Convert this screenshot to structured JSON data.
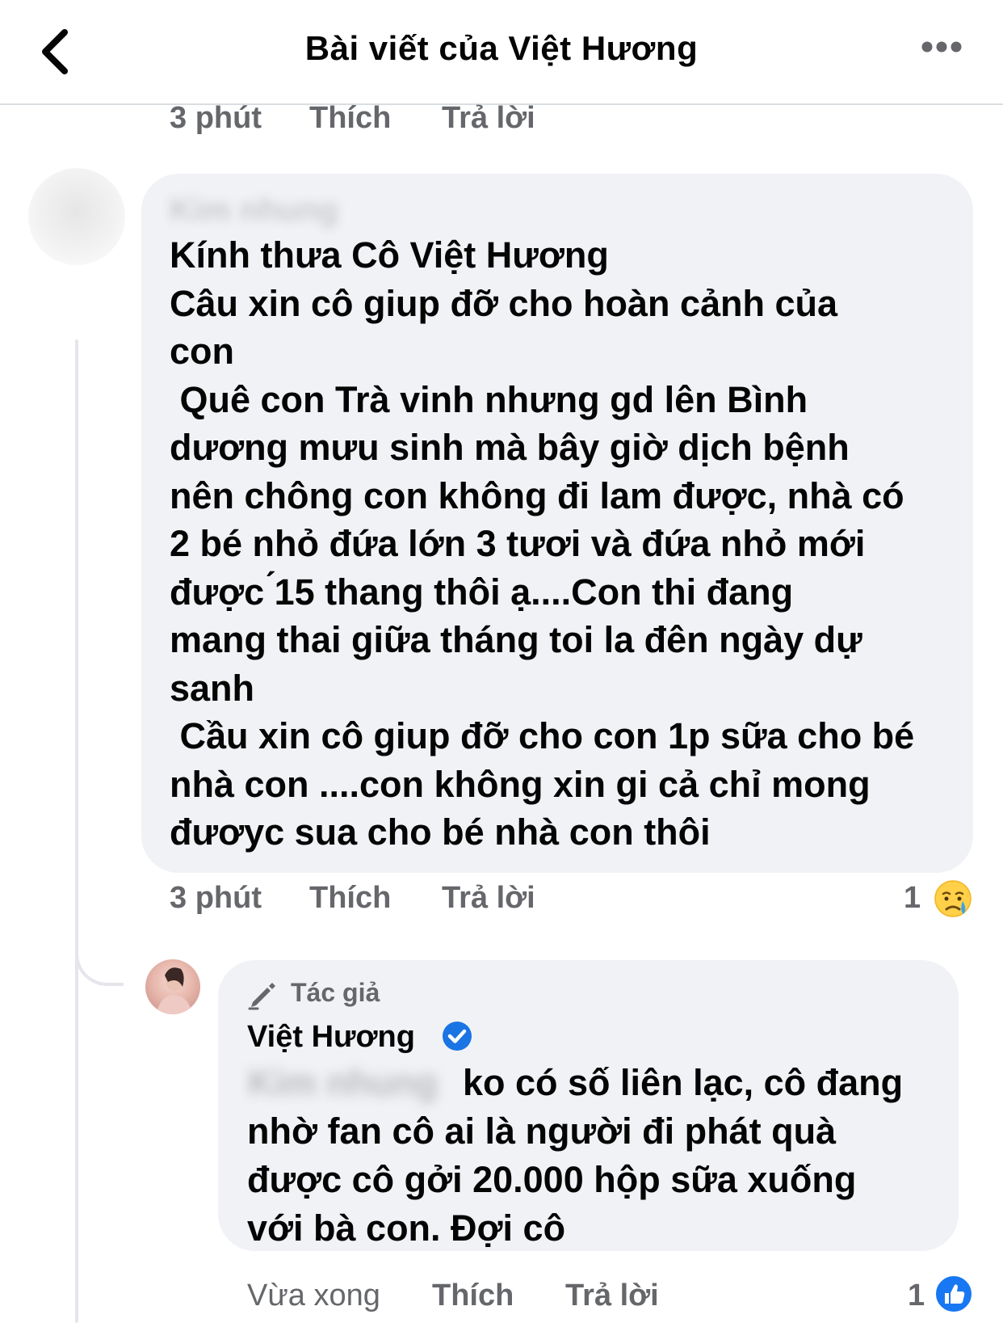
{
  "header": {
    "title": "Bài viết của Việt Hương",
    "back_icon": "chevron-left-icon",
    "more_icon": "more-horizontal-icon"
  },
  "previous_comment_actions": {
    "time": "3 phút",
    "like": "Thích",
    "reply": "Trả lời"
  },
  "comment": {
    "author_name": "Kim nhung",
    "lines": [
      "Kính thưa Cô Việt Hương",
      "Câu xin cô giup đỡ cho hoàn cảnh của",
      "con",
      " Quê con Trà vinh nhưng gd lên Bình",
      "dương mưu sinh mà bây giờ dịch bệnh",
      "nên chông con không đi lam được, nhà có",
      "2 bé nhỏ đứa lớn 3 tươi và đứa nhỏ mới",
      "được ́15 thang thôi ạ....Con thi đang",
      "mang thai giữa tháng toi la đên ngày dự",
      "sanh",
      " Cầu xin cô giup đỡ cho con 1p sữa cho bé",
      "nhà con ....con không xin gi cả chỉ mong",
      "đươyc sua cho bé nhà con thôi"
    ],
    "time": "3 phút",
    "like": "Thích",
    "reply": "Trả lời",
    "reaction_count": "1",
    "reaction_icon": "crying-face-icon"
  },
  "reply": {
    "author_badge": "Tác giả",
    "author_badge_icon": "pencil-icon",
    "author_name": "Việt Hương",
    "verified_icon": "verified-check-icon",
    "mention": "Kim nhung",
    "lines": [
      "ko có số liên lạc, cô đang",
      "nhờ fan cô ai là người đi phát quà",
      "được cô gởi 20.000 hộp sữa xuống",
      "với bà con. Đợi cô"
    ],
    "time": "Vừa xong",
    "like": "Thích",
    "reply": "Trả lời",
    "reaction_count": "1",
    "reaction_icon": "thumbs-up-icon"
  },
  "colors": {
    "bubble": "#f0f2f5",
    "meta_text": "#65676b",
    "verified_blue": "#1b74e4",
    "like_blue": "#1877f2"
  }
}
